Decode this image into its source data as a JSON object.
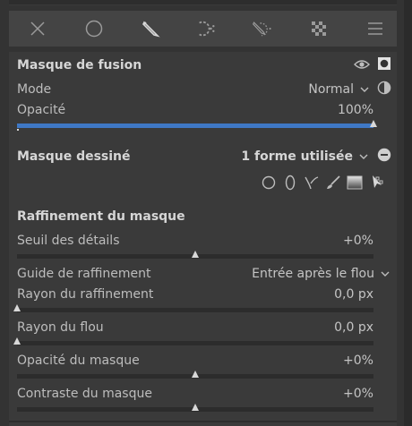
{
  "toolbar": {
    "icons": [
      "close-icon",
      "circle-icon",
      "pencil-icon",
      "parametric-icon",
      "drawn-parametric-icon",
      "raster-icon",
      "menu-icon"
    ]
  },
  "blend": {
    "title": "Masque de fusion",
    "mode_label": "Mode",
    "mode_value": "Normal",
    "opacity_label": "Opacité",
    "opacity_value": "100%",
    "opacity_fraction": 1.0
  },
  "drawn": {
    "title": "Masque dessiné",
    "shapes_value": "1 forme utilisée"
  },
  "refine": {
    "title": "Raffinement du masque",
    "detail_label": "Seuil des détails",
    "detail_value": "+0%",
    "detail_fraction": 0.5,
    "guide_label": "Guide de raffinement",
    "guide_value": "Entrée après le flou",
    "radius_label": "Rayon du raffinement",
    "radius_value": "0,0 px",
    "radius_fraction": 0.0,
    "blur_label": "Rayon du flou",
    "blur_value": "0,0 px",
    "blur_fraction": 0.0,
    "mask_opacity_label": "Opacité du masque",
    "mask_opacity_value": "+0%",
    "mask_opacity_fraction": 0.5,
    "contrast_label": "Contraste du masque",
    "contrast_value": "+0%",
    "contrast_fraction": 0.5
  },
  "colors": {
    "accent": "#3f78c5",
    "panel": "#3a3a3a",
    "toolbar": "#444444"
  }
}
